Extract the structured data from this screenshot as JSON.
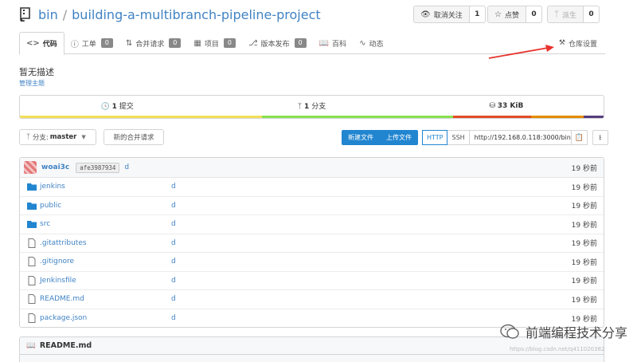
{
  "repo": {
    "owner": "bin",
    "separator": "/",
    "name": "building-a-multibranch-pipeline-project",
    "icon": "repo-icon"
  },
  "actions": {
    "unwatch": {
      "label": "取消关注",
      "count": "1",
      "icon": "eye-slash-icon"
    },
    "star": {
      "label": "点赞",
      "count": "0",
      "icon": "star-icon"
    },
    "fork": {
      "label": "派生",
      "count": "0",
      "icon": "fork-icon"
    }
  },
  "tabs": [
    {
      "label": "代码",
      "icon": "code-icon"
    },
    {
      "label": "工单",
      "badge": "0",
      "icon": "issue-icon"
    },
    {
      "label": "合并请求",
      "badge": "0",
      "icon": "pull-request-icon"
    },
    {
      "label": "项目",
      "badge": "0",
      "icon": "project-icon"
    },
    {
      "label": "版本发布",
      "badge": "0",
      "icon": "tag-icon"
    },
    {
      "label": "百科",
      "icon": "book-icon"
    },
    {
      "label": "动态",
      "icon": "pulse-icon"
    }
  ],
  "settings_tab": {
    "label": "仓库设置",
    "icon": "tools-icon"
  },
  "description": "暂无描述",
  "manage_topics": "管理主题",
  "stats": {
    "commits_count": "1",
    "commits_label": "提交",
    "branches_count": "1",
    "branches_label": "分支",
    "size": "33 KiB"
  },
  "language_colors": [
    "#f1e05a",
    "#89e051",
    "#e34c26",
    "#e38c00",
    "#563d7c"
  ],
  "language_shares": [
    0.415,
    0.327,
    0.134,
    0.09,
    0.034
  ],
  "toolbar": {
    "branch_prefix": "分支:",
    "branch_name": "master",
    "new_merge_request": "新的合并请求",
    "new_file": "新建文件",
    "upload_file": "上传文件",
    "http": "HTTP",
    "ssh": "SSH",
    "clone_url": "http://192.168.0.118:3000/bin/"
  },
  "latest_commit": {
    "user": "woai3c",
    "sha": "afe3987934",
    "message": "d",
    "time": "19 秒前"
  },
  "files": [
    {
      "name": "jenkins",
      "type": "folder",
      "message": "d",
      "time": "19 秒前"
    },
    {
      "name": "public",
      "type": "folder",
      "message": "d",
      "time": "19 秒前"
    },
    {
      "name": "src",
      "type": "folder",
      "message": "d",
      "time": "19 秒前"
    },
    {
      "name": ".gitattributes",
      "type": "file",
      "message": "d",
      "time": "19 秒前"
    },
    {
      "name": ".gitignore",
      "type": "file",
      "message": "d",
      "time": "19 秒前"
    },
    {
      "name": "Jenkinsfile",
      "type": "file",
      "message": "d",
      "time": "19 秒前"
    },
    {
      "name": "README.md",
      "type": "file",
      "message": "d",
      "time": "19 秒前"
    },
    {
      "name": "package.json",
      "type": "file",
      "message": "d",
      "time": "19 秒前"
    }
  ],
  "readme": {
    "title": "README.md",
    "icon": "book-icon"
  },
  "watermark": {
    "text": "前端编程技术分享",
    "url": "https://blog.csdn.net/q411020382"
  },
  "colors": {
    "link": "#4183c4",
    "primary": "#2185d0",
    "arrow": "#e8322d"
  }
}
